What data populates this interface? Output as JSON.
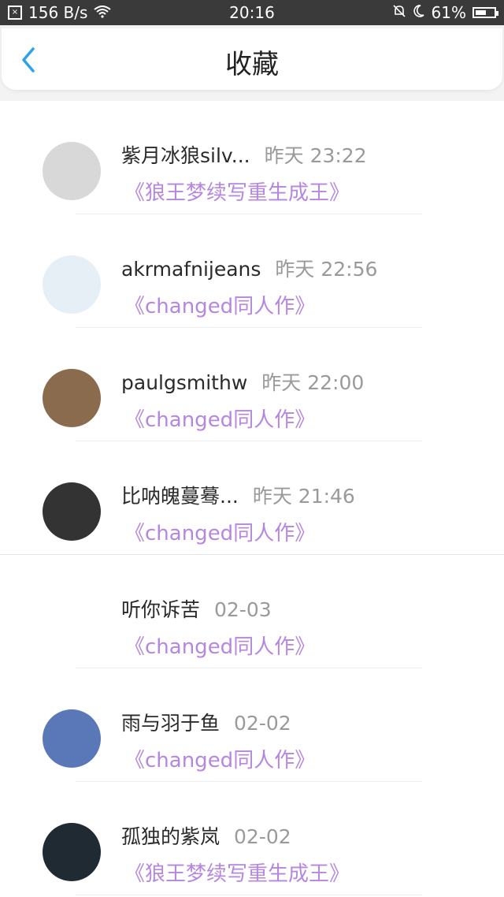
{
  "status_bar": {
    "speed": "156 B/s",
    "time": "20:16",
    "battery_percent": "61%",
    "battery_level": 0.61
  },
  "header": {
    "title": "收藏"
  },
  "items": [
    {
      "name": "紫月冰狼silv...",
      "time": "昨天 23:22",
      "book": "《狼王梦续写重生成王》",
      "avatar_color": "#d8d8d8"
    },
    {
      "name": "akrmafnijeans",
      "time": "昨天 22:56",
      "book": "《changed同人作》",
      "avatar_color": "#e6eef6"
    },
    {
      "name": "paulgsmithw",
      "time": "昨天 22:00",
      "book": "《changed同人作》",
      "avatar_color": "#8a6b4e"
    },
    {
      "name": "比呐魄蔓蓦...",
      "time": "昨天 21:46",
      "book": "《changed同人作》",
      "avatar_color": "#333333"
    },
    {
      "name": "听你诉苦",
      "time": "02-03",
      "book": "《changed同人作》",
      "avatar_color": "#ffffff"
    },
    {
      "name": "雨与羽于鱼",
      "time": "02-02",
      "book": "《changed同人作》",
      "avatar_color": "#5a78b8"
    },
    {
      "name": "孤独的紫岚",
      "time": "02-02",
      "book": "《狼王梦续写重生成王》",
      "avatar_color": "#1f2a33"
    }
  ]
}
